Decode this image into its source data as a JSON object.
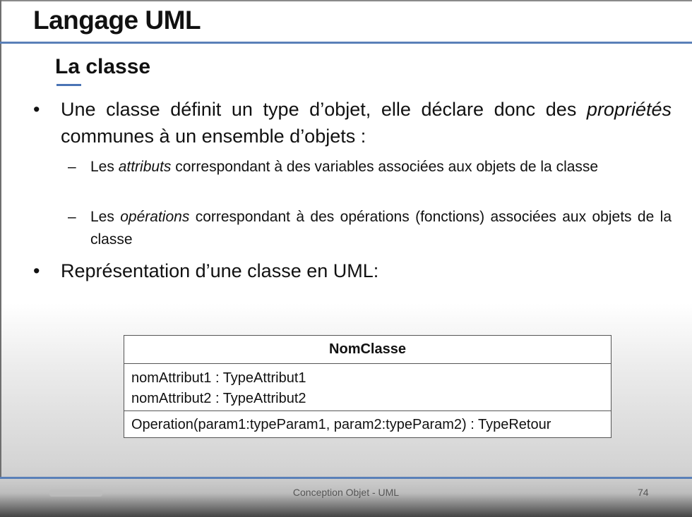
{
  "slide": {
    "title": "Langage UML",
    "subtitle": "La classe",
    "bullet_symbol": "•",
    "dash_symbol": "–",
    "bullets": [
      {
        "parts": [
          "Une classe définit un type d’objet, elle déclare donc des ",
          "propriétés",
          " communes à un ensemble d’objets :"
        ]
      },
      {
        "text": "Représentation d’une classe en UML:"
      }
    ],
    "sub_bullets": [
      {
        "parts": [
          "Les ",
          "attributs",
          " correspondant à des variables associées aux objets de la classe"
        ]
      },
      {
        "parts": [
          "Les ",
          "opérations",
          " correspondant à des opérations (fonctions) associées aux objets de la classe"
        ]
      }
    ]
  },
  "uml_class": {
    "name": "NomClasse",
    "attributes": [
      "nomAttribut1 : TypeAttribut1",
      "nomAttribut2 : TypeAttribut2"
    ],
    "operations": [
      "Operation(param1:typeParam1, param2:typeParam2) : TypeRetour"
    ]
  },
  "footer": {
    "center_text": "Conception Objet - UML",
    "page_number": "74"
  },
  "colors": {
    "accent_rule": "#5a80b8"
  }
}
